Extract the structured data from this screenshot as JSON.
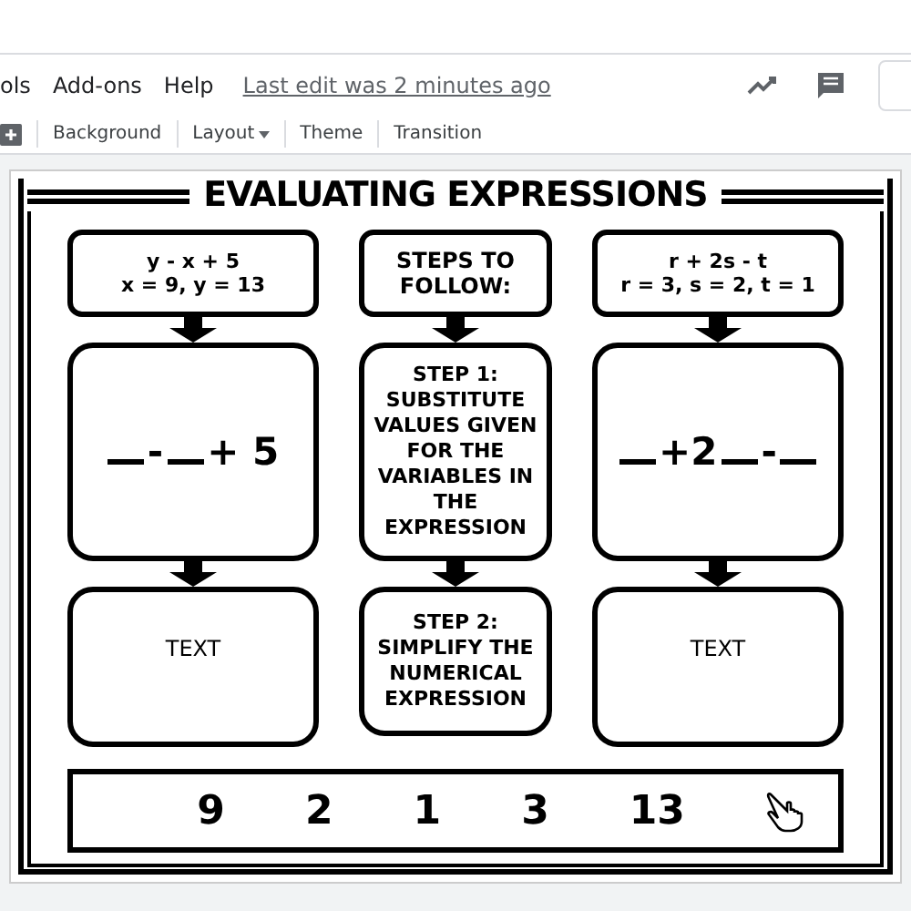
{
  "menu": {
    "items": [
      "ols",
      "Add-ons",
      "Help"
    ],
    "last_edit": "Last edit was 2 minutes ago"
  },
  "toolbar": [
    {
      "label": "Background",
      "kind": "button"
    },
    {
      "label": "Layout",
      "kind": "dropdown"
    },
    {
      "label": "Theme",
      "kind": "button"
    },
    {
      "label": "Transition",
      "kind": "button"
    }
  ],
  "slide": {
    "title": "EVALUATING EXPRESSIONS",
    "problems": [
      {
        "lines": [
          "y - x + 5",
          "x = 9, y = 13"
        ],
        "equation": [
          {
            "kind": "blank"
          },
          {
            "kind": "text",
            "text": "-"
          },
          {
            "kind": "blank"
          },
          {
            "kind": "text",
            "text": "+ 5"
          }
        ],
        "answer": "TEXT"
      },
      {
        "lines": [
          "r + 2s - t",
          "r = 3, s = 2, t = 1"
        ],
        "equation": [
          {
            "kind": "blank"
          },
          {
            "kind": "text",
            "text": "+2"
          },
          {
            "kind": "blank"
          },
          {
            "kind": "text",
            "text": "-"
          },
          {
            "kind": "blank"
          }
        ],
        "answer": "TEXT"
      }
    ],
    "steps_heading": "STEPS TO FOLLOW:",
    "steps": [
      "STEP 1: SUBSTITUTE VALUES GIVEN FOR THE VARIABLES IN THE EXPRESSION",
      "STEP 2: SIMPLIFY THE NUMERICAL EXPRESSION"
    ],
    "number_bank": [
      "9",
      "2",
      "1",
      "3",
      "13"
    ]
  }
}
